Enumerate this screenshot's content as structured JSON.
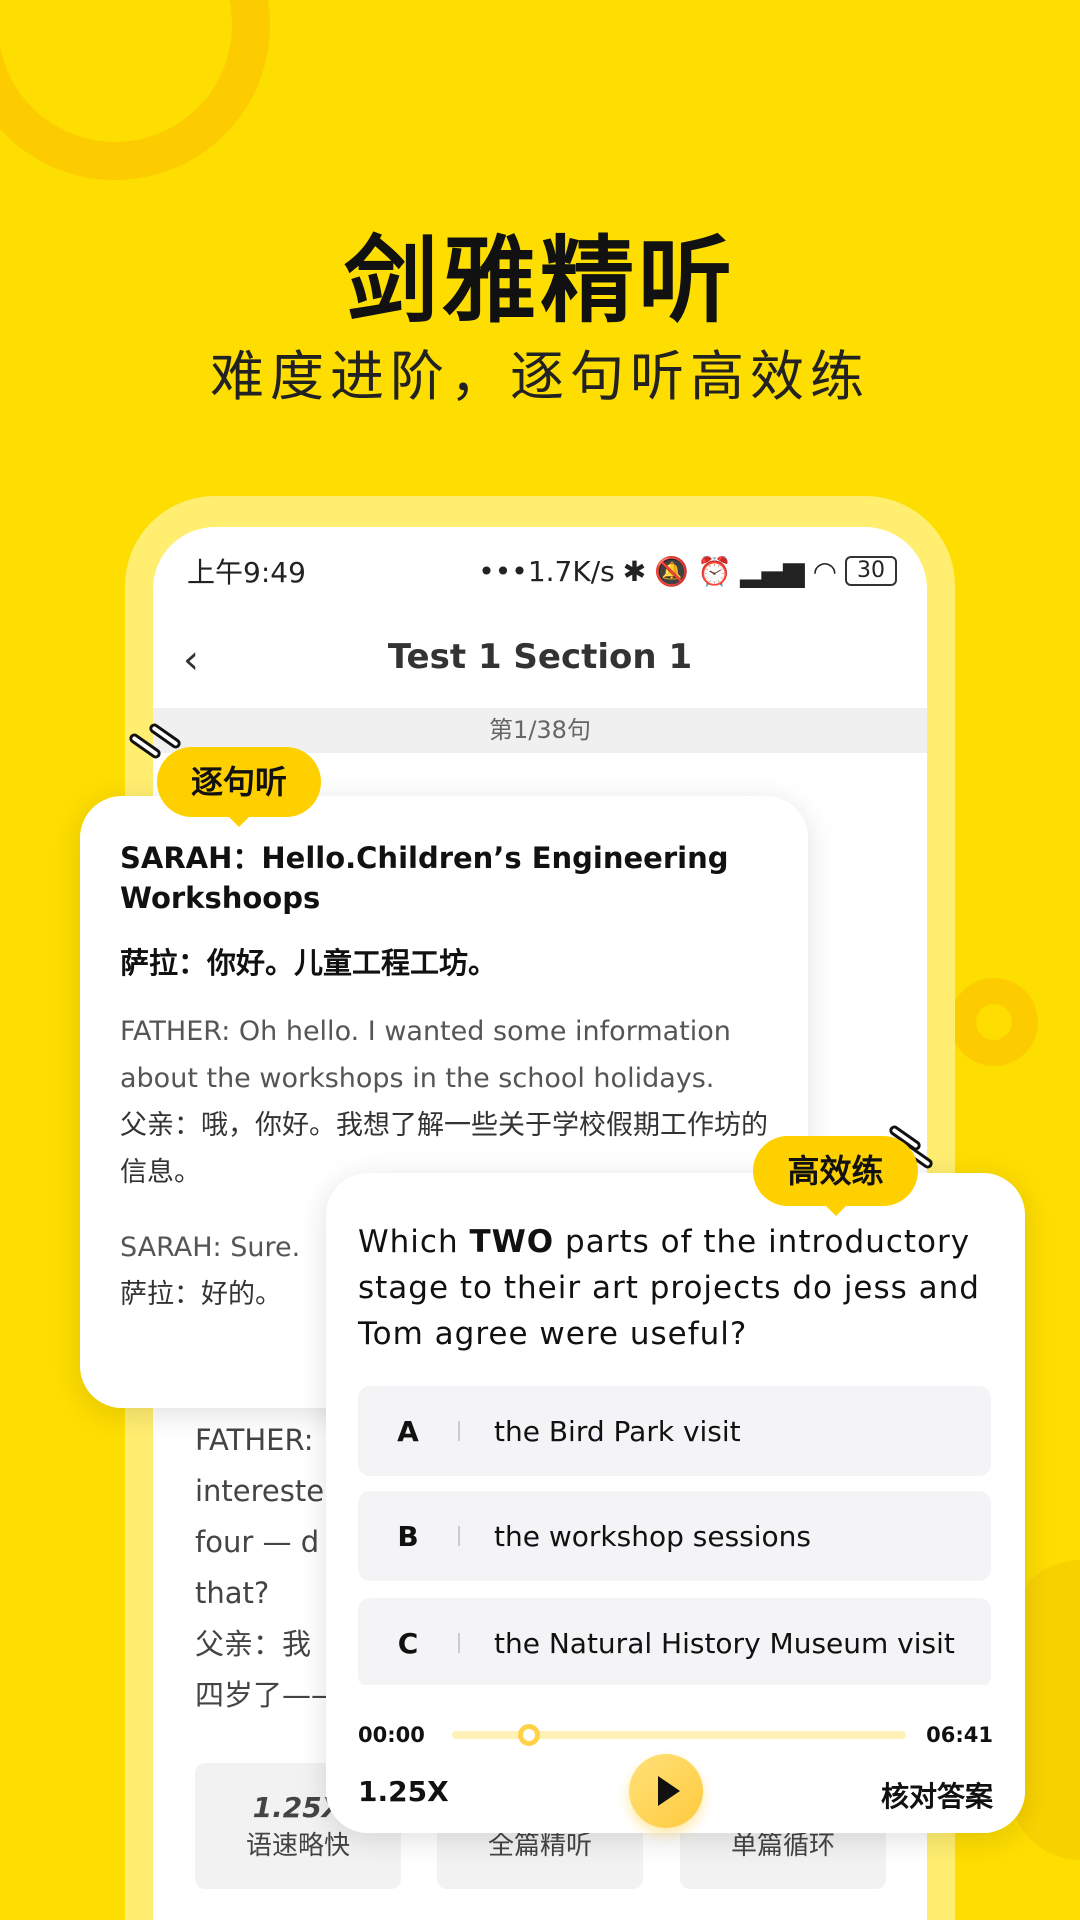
{
  "headline": {
    "title": "剑雅精听",
    "subtitle": "难度进阶，逐句听高效练"
  },
  "status_bar": {
    "time": "上午9:49",
    "net_speed": "•••1.7K/s",
    "icons": [
      "bluetooth-icon",
      "bell-off-icon",
      "alarm-icon",
      "signal-hd-icon",
      "signal-icon",
      "wifi-icon"
    ],
    "battery": "30"
  },
  "nav": {
    "title": "Test 1 Section 1"
  },
  "counter": "第1/38句",
  "sentence_card": {
    "tag": "逐句听",
    "current_en": "SARAH：Hello.Children’s Engineering Workshoops",
    "current_zh": "萨拉：你好。儿童工程工坊。",
    "next_en": "FATHER: Oh hello. I wanted some information about the workshops in the school holidays.",
    "next_zh": "父亲：哦，你好。我想了解一些关于学校假期工作坊的信息。",
    "third_en": "SARAH: Sure.",
    "third_zh": "萨拉：好的。"
  },
  "background_text": [
    "FATHER:",
    "intereste",
    "four — d",
    "that?",
    "父亲：我",
    "四岁了——"
  ],
  "bottom_buttons": [
    {
      "value": "1.25X",
      "label": "语速略快"
    },
    {
      "value": "",
      "label": "全篇精听"
    },
    {
      "value": "",
      "label": "单篇循环"
    }
  ],
  "practice_card": {
    "tag": "高效练",
    "question_pre": "Which ",
    "question_bold": "TWO",
    "question_post": " parts of the introductory stage to their art projects do jess and Tom agree were useful?",
    "options": [
      {
        "key": "A",
        "text": "the Bird Park visit"
      },
      {
        "key": "B",
        "text": "the workshop sessions"
      },
      {
        "key": "C",
        "text": "the Natural  History Museum visit"
      }
    ]
  },
  "player": {
    "current": "00:00",
    "total": "06:41",
    "progress_percent": 17,
    "speed": "1.25X",
    "check_answer": "核对答案"
  },
  "colors": {
    "background": "#FEDD00",
    "accent": "#FFD000"
  }
}
